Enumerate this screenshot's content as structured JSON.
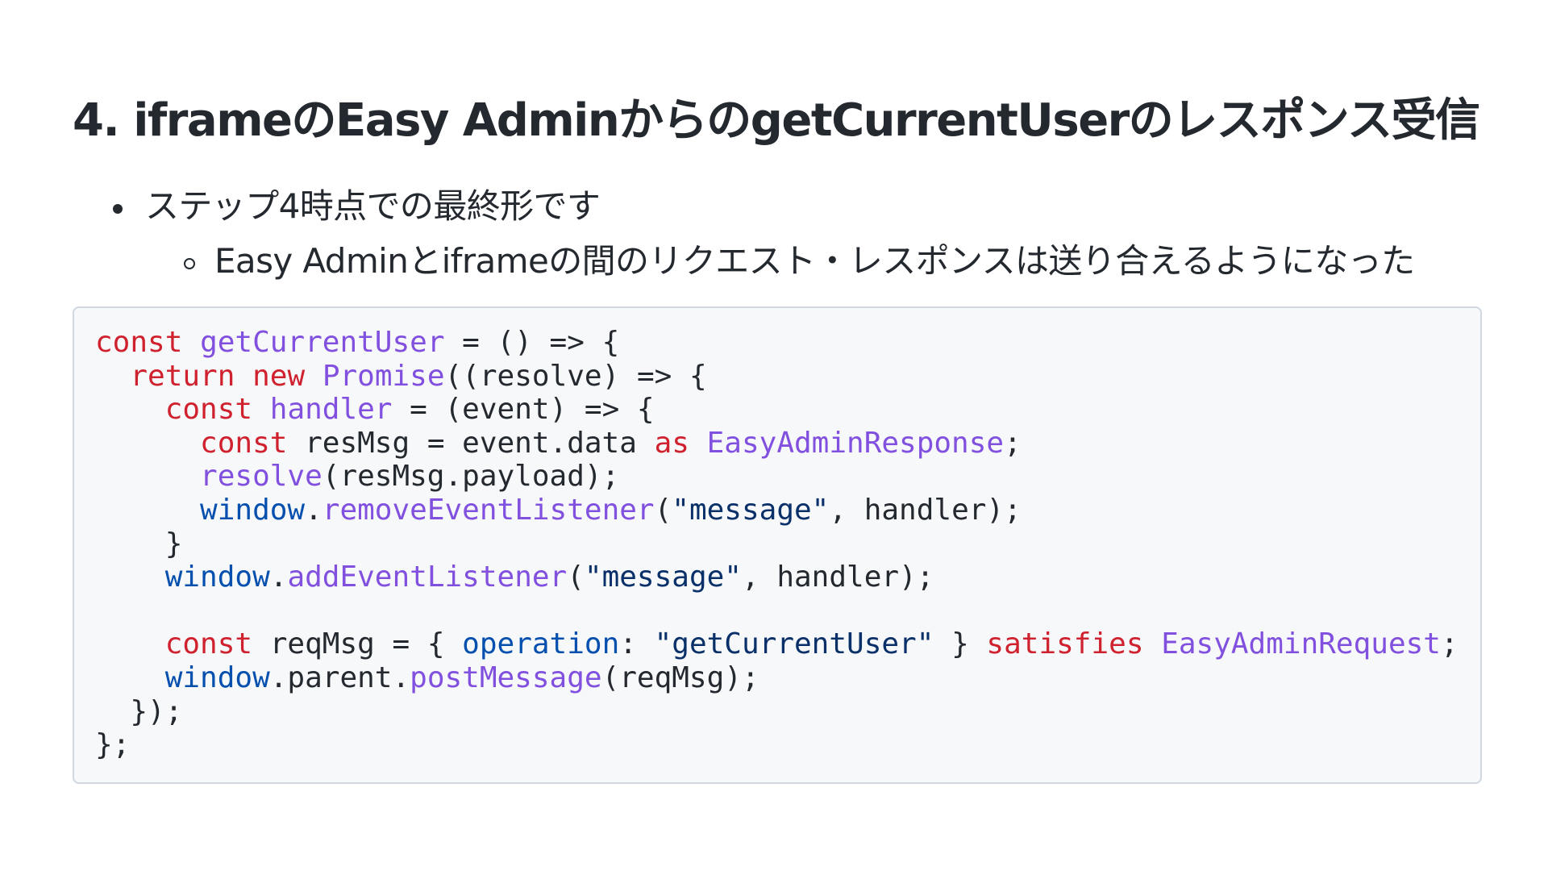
{
  "title": "4. iframeのEasy AdminからのgetCurrentUserのレスポンス受信",
  "bullets": [
    {
      "text": "ステップ4時点での最終形です"
    },
    {
      "text": "Easy Adminとiframeの間のリクエスト・レスポンスは送り合えるようになった"
    }
  ],
  "code_language": "typescript",
  "code_lines": [
    [
      {
        "t": "const",
        "c": "kw"
      },
      {
        "t": " "
      },
      {
        "t": "getCurrentUser",
        "c": "fn"
      },
      {
        "t": " = () => {"
      }
    ],
    [
      {
        "t": "  "
      },
      {
        "t": "return",
        "c": "kw"
      },
      {
        "t": " "
      },
      {
        "t": "new",
        "c": "kw"
      },
      {
        "t": " "
      },
      {
        "t": "Promise",
        "c": "fn"
      },
      {
        "t": "((resolve) => {"
      }
    ],
    [
      {
        "t": "    "
      },
      {
        "t": "const",
        "c": "kw"
      },
      {
        "t": " "
      },
      {
        "t": "handler",
        "c": "fn"
      },
      {
        "t": " = (event) => {"
      }
    ],
    [
      {
        "t": "      "
      },
      {
        "t": "const",
        "c": "kw"
      },
      {
        "t": " resMsg = event.data "
      },
      {
        "t": "as",
        "c": "kw"
      },
      {
        "t": " "
      },
      {
        "t": "EasyAdminResponse",
        "c": "fn"
      },
      {
        "t": ";"
      }
    ],
    [
      {
        "t": "      "
      },
      {
        "t": "resolve",
        "c": "fn"
      },
      {
        "t": "(resMsg.payload);"
      }
    ],
    [
      {
        "t": "      "
      },
      {
        "t": "window",
        "c": "ent"
      },
      {
        "t": "."
      },
      {
        "t": "removeEventListener",
        "c": "fn"
      },
      {
        "t": "("
      },
      {
        "t": "\"message\"",
        "c": "str"
      },
      {
        "t": ", handler);"
      }
    ],
    [
      {
        "t": "    }"
      }
    ],
    [
      {
        "t": "    "
      },
      {
        "t": "window",
        "c": "ent"
      },
      {
        "t": "."
      },
      {
        "t": "addEventListener",
        "c": "fn"
      },
      {
        "t": "("
      },
      {
        "t": "\"message\"",
        "c": "str"
      },
      {
        "t": ", handler);"
      }
    ],
    [
      {
        "t": ""
      }
    ],
    [
      {
        "t": "    "
      },
      {
        "t": "const",
        "c": "kw"
      },
      {
        "t": " reqMsg = { "
      },
      {
        "t": "operation",
        "c": "ent"
      },
      {
        "t": ": "
      },
      {
        "t": "\"getCurrentUser\"",
        "c": "str"
      },
      {
        "t": " } "
      },
      {
        "t": "satisfies",
        "c": "kw"
      },
      {
        "t": " "
      },
      {
        "t": "EasyAdminRequest",
        "c": "fn"
      },
      {
        "t": ";"
      }
    ],
    [
      {
        "t": "    "
      },
      {
        "t": "window",
        "c": "ent"
      },
      {
        "t": ".parent."
      },
      {
        "t": "postMessage",
        "c": "fn"
      },
      {
        "t": "(reqMsg);"
      }
    ],
    [
      {
        "t": "  });"
      }
    ],
    [
      {
        "t": "};"
      }
    ]
  ]
}
